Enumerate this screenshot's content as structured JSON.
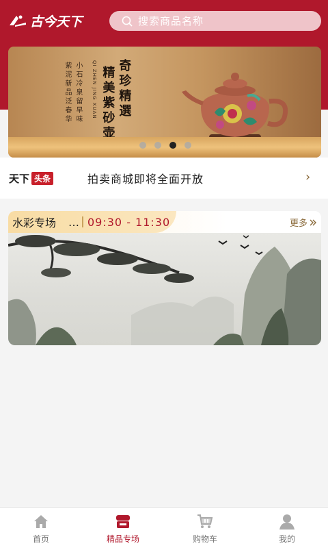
{
  "header": {
    "logo_text": "古今天下",
    "search_placeholder": "搜索商品名称"
  },
  "banner": {
    "text_col_1": "小石冷泉留早味",
    "text_col_2": "紫泥新品泛春华",
    "text_en": "QI ZHEN JING XUAN",
    "title_col_1": "奇珍精選",
    "title_col_2": "精美紫砂壶",
    "dots": 4,
    "active_dot": 2
  },
  "news": {
    "brand_a": "天下",
    "brand_b": "头条",
    "headline": "拍卖商城即将全面开放",
    "arrow": "›"
  },
  "auction": {
    "title": "水彩专场",
    "time": "09:30 - 11:30",
    "more": "更多"
  },
  "tabbar": [
    {
      "label": "首页",
      "icon": "home-icon",
      "active": false
    },
    {
      "label": "精品专场",
      "icon": "boutique-icon",
      "active": true
    },
    {
      "label": "购物车",
      "icon": "cart-icon",
      "active": false
    },
    {
      "label": "我的",
      "icon": "profile-icon",
      "active": false
    }
  ],
  "colors": {
    "brand_red": "#b0182c",
    "gold": "#c9a25c"
  }
}
